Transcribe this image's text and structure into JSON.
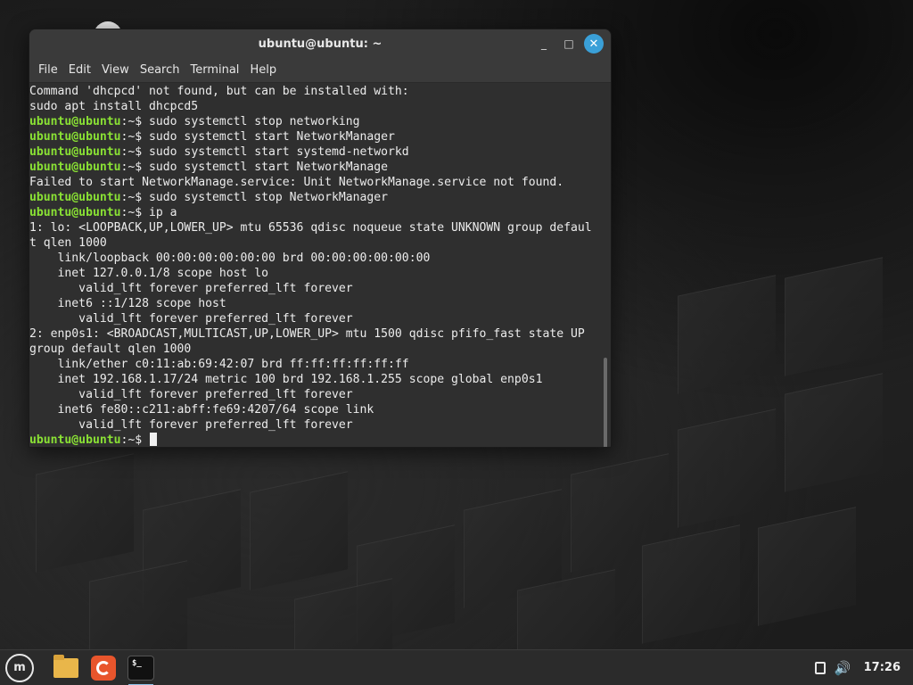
{
  "window": {
    "title": "ubuntu@ubuntu: ~",
    "controls": {
      "minimize": "_",
      "maximize": "□",
      "close": "✕"
    }
  },
  "menu": [
    "File",
    "Edit",
    "View",
    "Search",
    "Terminal",
    "Help"
  ],
  "terminal": {
    "lines": [
      {
        "prompt": "",
        "text": "Command 'dhcpcd' not found, but can be installed with:"
      },
      {
        "prompt": "",
        "text": "sudo apt install dhcpcd5"
      },
      {
        "prompt": "ubuntu@ubuntu",
        "text": ":~$ sudo systemctl stop networking"
      },
      {
        "prompt": "ubuntu@ubuntu",
        "text": ":~$ sudo systemctl start NetworkManager"
      },
      {
        "prompt": "ubuntu@ubuntu",
        "text": ":~$ sudo systemctl start systemd-networkd"
      },
      {
        "prompt": "ubuntu@ubuntu",
        "text": ":~$ sudo systemctl start NetworkManage"
      },
      {
        "prompt": "",
        "text": "Failed to start NetworkManage.service: Unit NetworkManage.service not found."
      },
      {
        "prompt": "ubuntu@ubuntu",
        "text": ":~$ sudo systemctl stop NetworkManager"
      },
      {
        "prompt": "ubuntu@ubuntu",
        "text": ":~$ ip a"
      },
      {
        "prompt": "",
        "text": "1: lo: <LOOPBACK,UP,LOWER_UP> mtu 65536 qdisc noqueue state UNKNOWN group defaul"
      },
      {
        "prompt": "",
        "text": "t qlen 1000"
      },
      {
        "prompt": "",
        "text": "    link/loopback 00:00:00:00:00:00 brd 00:00:00:00:00:00"
      },
      {
        "prompt": "",
        "text": "    inet 127.0.0.1/8 scope host lo"
      },
      {
        "prompt": "",
        "text": "       valid_lft forever preferred_lft forever"
      },
      {
        "prompt": "",
        "text": "    inet6 ::1/128 scope host"
      },
      {
        "prompt": "",
        "text": "       valid_lft forever preferred_lft forever"
      },
      {
        "prompt": "",
        "text": "2: enp0s1: <BROADCAST,MULTICAST,UP,LOWER_UP> mtu 1500 qdisc pfifo_fast state UP"
      },
      {
        "prompt": "",
        "text": "group default qlen 1000"
      },
      {
        "prompt": "",
        "text": "    link/ether c0:11:ab:69:42:07 brd ff:ff:ff:ff:ff:ff"
      },
      {
        "prompt": "",
        "text": "    inet 192.168.1.17/24 metric 100 brd 192.168.1.255 scope global enp0s1"
      },
      {
        "prompt": "",
        "text": "       valid_lft forever preferred_lft forever"
      },
      {
        "prompt": "",
        "text": "    inet6 fe80::c211:abff:fe69:4207/64 scope link"
      },
      {
        "prompt": "",
        "text": "       valid_lft forever preferred_lft forever"
      },
      {
        "prompt": "ubuntu@ubuntu",
        "text": ":~$ "
      }
    ]
  },
  "taskbar": {
    "menu_icon": "mint-menu-icon",
    "launchers": [
      {
        "icon": "folder-icon"
      },
      {
        "icon": "firefox-icon"
      },
      {
        "icon": "terminal-icon",
        "glyph": "$_"
      }
    ],
    "clock": "17:26"
  },
  "colors": {
    "prompt": "#8ae234",
    "terminal_bg": "#2f2f2f",
    "close_button": "#3aa0d8"
  }
}
